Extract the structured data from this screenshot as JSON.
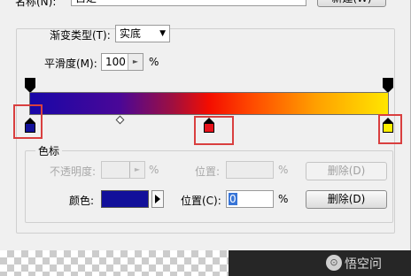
{
  "name_row": {
    "label": "名称(N):",
    "value": "自定",
    "new_button": "新建(W)"
  },
  "gradient_type": {
    "label": "渐变类型(T):",
    "value": "实底"
  },
  "smoothness": {
    "label": "平滑度(M):",
    "value": "100",
    "unit": "%"
  },
  "gradient": {
    "colors": [
      "#1807a8",
      "#f40d00",
      "#ffe600"
    ],
    "color_stops": [
      {
        "position_percent": 0,
        "color": "#12109a"
      },
      {
        "position_percent": 50,
        "color": "#e8131b"
      },
      {
        "position_percent": 100,
        "color": "#fff000"
      }
    ],
    "opacity_stops_percent": [
      0,
      100
    ],
    "midpoint_percent": 25,
    "highlight_color": "#d93f3f"
  },
  "color_stops_panel": {
    "title": "色标",
    "opacity_label": "不透明度:",
    "opacity_unit": "%",
    "opacity_location_label": "位置:",
    "opacity_location_unit": "%",
    "opacity_delete": "删除(D)",
    "color_label": "颜色:",
    "color_value": "#12109a",
    "location_label": "位置(C):",
    "location_value": "0",
    "location_unit": "%",
    "delete_button": "删除(D)"
  },
  "watermark": {
    "logo": "⊙",
    "text": "悟空问"
  }
}
